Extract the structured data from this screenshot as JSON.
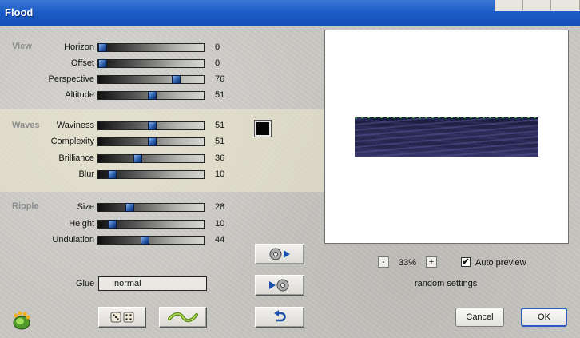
{
  "window": {
    "title": "Flood"
  },
  "sections": {
    "view": "View",
    "waves": "Waves",
    "ripple": "Ripple"
  },
  "sliders": [
    {
      "label": "Horizon",
      "value": "0",
      "fraction": 0.0
    },
    {
      "label": "Offset",
      "value": "0",
      "fraction": 0.0
    },
    {
      "label": "Perspective",
      "value": "76",
      "fraction": 0.76
    },
    {
      "label": "Altitude",
      "value": "51",
      "fraction": 0.51
    },
    {
      "label": "Waviness",
      "value": "51",
      "fraction": 0.51
    },
    {
      "label": "Complexity",
      "value": "51",
      "fraction": 0.51
    },
    {
      "label": "Brilliance",
      "value": "36",
      "fraction": 0.36
    },
    {
      "label": "Blur",
      "value": "10",
      "fraction": 0.1
    },
    {
      "label": "Size",
      "value": "28",
      "fraction": 0.28
    },
    {
      "label": "Height",
      "value": "10",
      "fraction": 0.1
    },
    {
      "label": "Undulation",
      "value": "44",
      "fraction": 0.44
    }
  ],
  "glue": {
    "label": "Glue",
    "value": "normal"
  },
  "preview": {
    "zoom_minus": "-",
    "zoom_value": "33%",
    "zoom_plus": "+",
    "auto_preview_label": "Auto preview",
    "auto_preview_checked": "✔",
    "random_settings_label": "random settings"
  },
  "buttons": {
    "cancel": "Cancel",
    "ok": "OK"
  },
  "icons": {
    "logo": "flood-logo-icon",
    "dice": "dice-icon",
    "wave": "wave-icon",
    "play_forward": "play-forward-icon",
    "play_back": "play-back-icon",
    "undo": "undo-arrow-icon"
  },
  "colors": {
    "title_bar": "#1d5cc7",
    "swatch": "#050505",
    "waves_band": "#ece9ce"
  }
}
